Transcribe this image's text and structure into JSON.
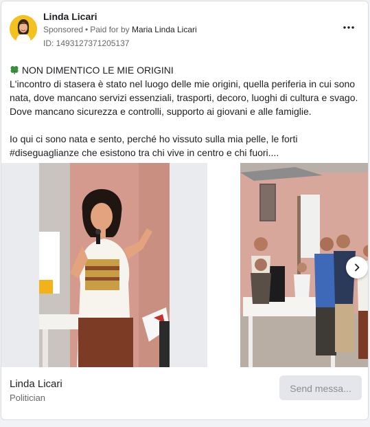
{
  "post": {
    "page_name": "Linda Licari",
    "sponsored_label": "Sponsored",
    "paid_for_prefix": "Paid for by",
    "paid_for_name": "Maria Linda Licari",
    "ad_id": "ID: 1493127371205137",
    "more_icon": "more-dots-icon",
    "headline": "NON DIMENTICO LE MIE ORIGINI",
    "headline_icon": "clover-icon",
    "paragraph1": "L'incontro di stasera è stato nel luogo delle mie origini, quella periferia in cui sono nata, dove mancano servizi essenziali, trasporti, decoro, luoghi di cultura e svago. Dove mancano sicurezza e controlli, supporto ai giovani e alle famiglie.",
    "paragraph2": "Io qui ci sono nata e sento, perché ho vissuto sulla mia pelle, le forti #diseguaglianze che esistono tra chi vive in centro e chi fuori...."
  },
  "footer": {
    "page_name": "Linda Licari",
    "category": "Politician",
    "cta_label": "Send messa..."
  },
  "colors": {
    "avatar_bg": "#f4c21f",
    "text_primary": "#1c1e21",
    "text_secondary": "#65676b",
    "button_bg": "#e4e6eb"
  }
}
